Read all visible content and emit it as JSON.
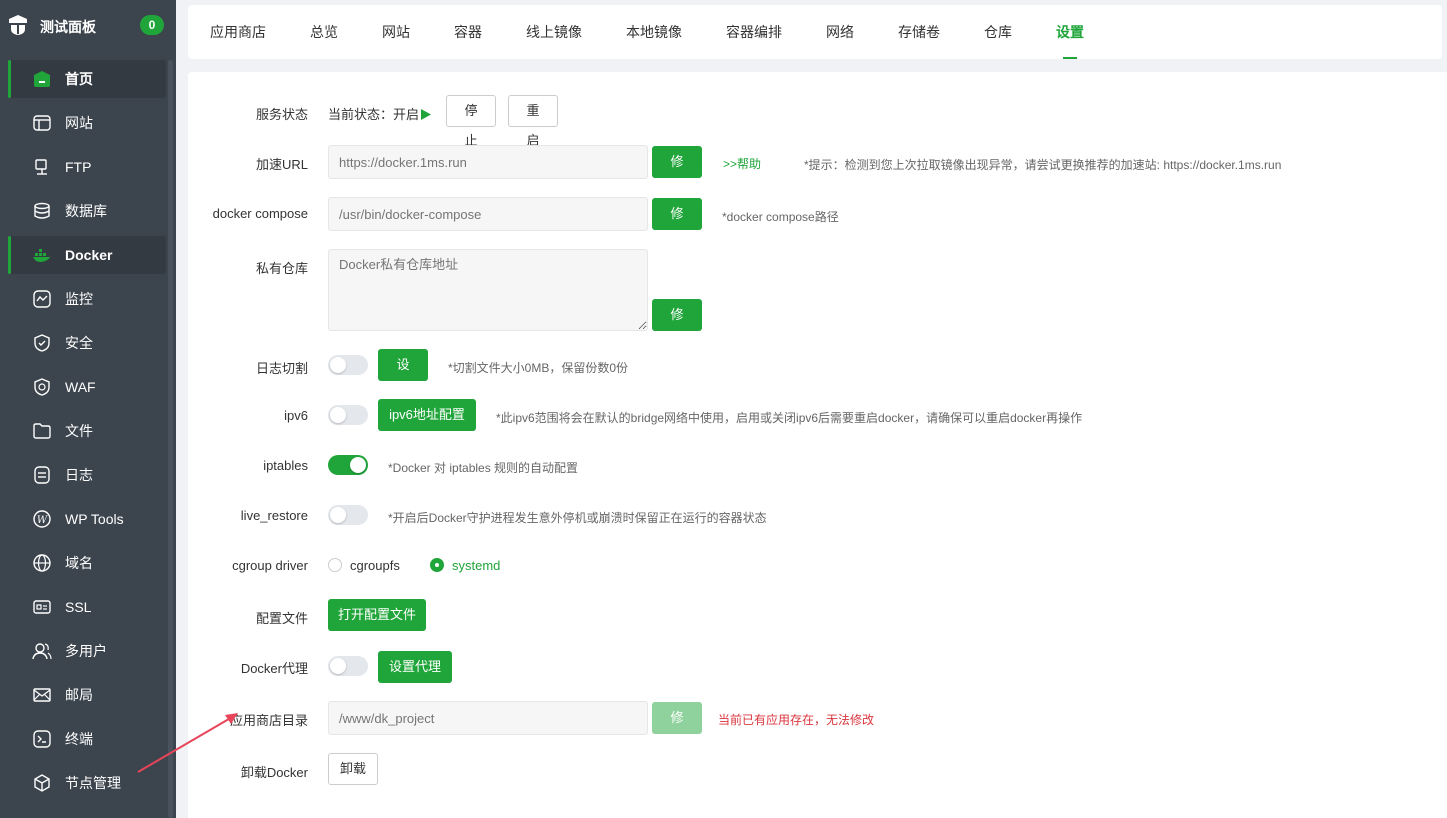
{
  "sidebar": {
    "title": "测试面板",
    "badge": "0",
    "items": [
      {
        "label": "首页",
        "icon": "home-icon",
        "active": true
      },
      {
        "label": "网站",
        "icon": "website-icon",
        "active": false
      },
      {
        "label": "FTP",
        "icon": "ftp-icon",
        "active": false
      },
      {
        "label": "数据库",
        "icon": "database-icon",
        "active": false
      },
      {
        "label": "Docker",
        "icon": "docker-icon",
        "active": true
      },
      {
        "label": "监控",
        "icon": "monitor-icon",
        "active": false
      },
      {
        "label": "安全",
        "icon": "shield-icon",
        "active": false
      },
      {
        "label": "WAF",
        "icon": "waf-icon",
        "active": false
      },
      {
        "label": "文件",
        "icon": "folder-icon",
        "active": false
      },
      {
        "label": "日志",
        "icon": "log-icon",
        "active": false
      },
      {
        "label": "WP Tools",
        "icon": "wordpress-icon",
        "active": false
      },
      {
        "label": "域名",
        "icon": "domain-icon",
        "active": false
      },
      {
        "label": "SSL",
        "icon": "ssl-icon",
        "active": false
      },
      {
        "label": "多用户",
        "icon": "users-icon",
        "active": false
      },
      {
        "label": "邮局",
        "icon": "mail-icon",
        "active": false
      },
      {
        "label": "终端",
        "icon": "terminal-icon",
        "active": false
      },
      {
        "label": "节点管理",
        "icon": "node-icon",
        "active": false
      }
    ]
  },
  "tabs": [
    "应用商店",
    "总览",
    "网站",
    "容器",
    "线上镜像",
    "本地镜像",
    "容器编排",
    "网络",
    "存储卷",
    "仓库",
    "设置"
  ],
  "active_tab": "设置",
  "settings": {
    "service": {
      "label": "服务状态",
      "status": "当前状态：开启",
      "stop": "停止",
      "restart": "重启"
    },
    "mirror": {
      "label": "加速URL",
      "placeholder": "https://docker.1ms.run",
      "btn": "修改",
      "help": ">>帮助",
      "tip": "*提示：检测到您上次拉取镜像出现异常，请尝试更换推荐的加速站: https://docker.1ms.run"
    },
    "compose": {
      "label": "docker compose",
      "placeholder": "/usr/bin/docker-compose",
      "btn": "修改",
      "tip": "*docker compose路径"
    },
    "registry": {
      "label": "私有仓库",
      "placeholder": "Docker私有仓库地址",
      "btn": "修改"
    },
    "logcut": {
      "label": "日志切割",
      "btn": "设置",
      "tip": "*切割文件大小0MB，保留份数0份",
      "on": false
    },
    "ipv6": {
      "label": "ipv6",
      "btn": "ipv6地址配置",
      "tip": "*此ipv6范围将会在默认的bridge网络中使用，启用或关闭ipv6后需要重启docker，请确保可以重启docker再操作",
      "on": false
    },
    "iptables": {
      "label": "iptables",
      "tip": "*Docker 对 iptables 规则的自动配置",
      "on": true
    },
    "live_restore": {
      "label": "live_restore",
      "tip": "*开启后Docker守护进程发生意外停机或崩溃时保留正在运行的容器状态",
      "on": false
    },
    "cgroup": {
      "label": "cgroup driver",
      "options": [
        "cgroupfs",
        "systemd"
      ],
      "selected": "systemd"
    },
    "config": {
      "label": "配置文件",
      "btn": "打开配置文件"
    },
    "proxy": {
      "label": "Docker代理",
      "btn": "设置代理",
      "on": false
    },
    "store_dir": {
      "label": "应用商店目录",
      "placeholder": "/www/dk_project",
      "btn": "修改",
      "err": "当前已有应用存在，无法修改"
    },
    "uninstall": {
      "label": "卸载Docker",
      "btn": "卸载"
    }
  },
  "colors": {
    "accent": "#20a53a",
    "sidebar_bg": "#3c444d",
    "error": "#d9363e",
    "annotation_arrow": "#e8445a"
  }
}
